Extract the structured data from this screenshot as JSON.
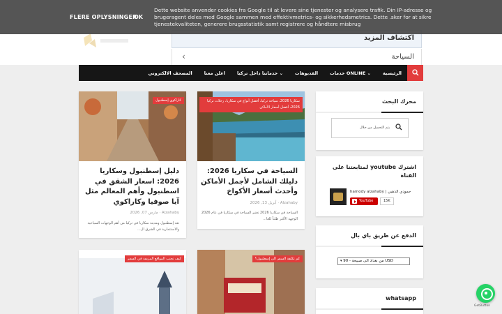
{
  "cookie_bar": {
    "more_info": "FLERE OPLYSNINGER",
    "ok": "OK",
    "text": "Dette website anvender cookies fra Google til at levere sine tjenester og analysere trafik. Din IP-adresse og brugeragent deles med Google sammen med effektivmetrics- og sikkerhedsmetrics. Dette .sker for at sikre tjenestekvaliteten, generere brugsstatistik samt registrere og håndtere misbrug"
  },
  "header": {
    "explore_label": "اكتشاف المزيد",
    "tourism_label": "السياحة",
    "chevron": "‹"
  },
  "nav": {
    "items": [
      "الرئيسية",
      "خدمات ONLINE ⌄",
      "الفديوهات",
      "خدماتنا داخل تركيا ⌄",
      "اعلن معنا",
      "المصحف الالكتروني"
    ],
    "search_icon": "search-icon"
  },
  "posts": [
    {
      "tag": "سكاريا 2026، سياحة تركيا، أفضل أنواع في سكاريا، رحلات تركيا 2026، أفضل أسعار الأماكن",
      "title": "السياحة في سكاريا 2026: دليلك الشامل لأجمل الأماكن وأحدث أسعار الأكواخ",
      "meta": "Alzahaby · أبريل 13, 2026",
      "excerpt": "السياحة في سكاريا 2026 تعتبر السياحة في سكاريا في عام 2026 الوجهة الأكثر طلباً للعا..."
    },
    {
      "tag": "كاراكوي إسطنبول",
      "title": "دليل إسطنبول وسكاريا 2026: اسعار الشقق في اسطنبول وأهم المعالم مثل آيا صوفيا وكاراكوي",
      "meta": "Alzahaby · مارس 07, 2026",
      "excerpt": "تعد إسطنبول ومدينة سكاريا في تركيا من أهم الوجهات السياحية والاستثمارية في الشرق ال..."
    },
    {
      "tag": "كم تكلفة السفر الى إسطنبول؟",
      "title": "",
      "meta": "",
      "excerpt": ""
    },
    {
      "tag": "كيف تجنب المواقع المزيفة في السفر",
      "title": "",
      "meta": "",
      "excerpt": ""
    }
  ],
  "sidebar": {
    "search": {
      "title": "محرك البحث",
      "placeholder": "يتم التحميل من خلال",
      "icon": "search-icon"
    },
    "youtube": {
      "title": "اشترك youtube لمتابعتنا على القناة",
      "channel": "hamody alzahaby | حمودي الذهبي",
      "button": "YouTube",
      "count": "15K"
    },
    "paypal": {
      "title": "الدفع عن طريق باي بال",
      "selected": "من بغداد الى صبيحة - 90 USD"
    },
    "whatsapp": {
      "title": "whatsapp"
    }
  },
  "floating": {
    "getbutton": "GetButton"
  }
}
